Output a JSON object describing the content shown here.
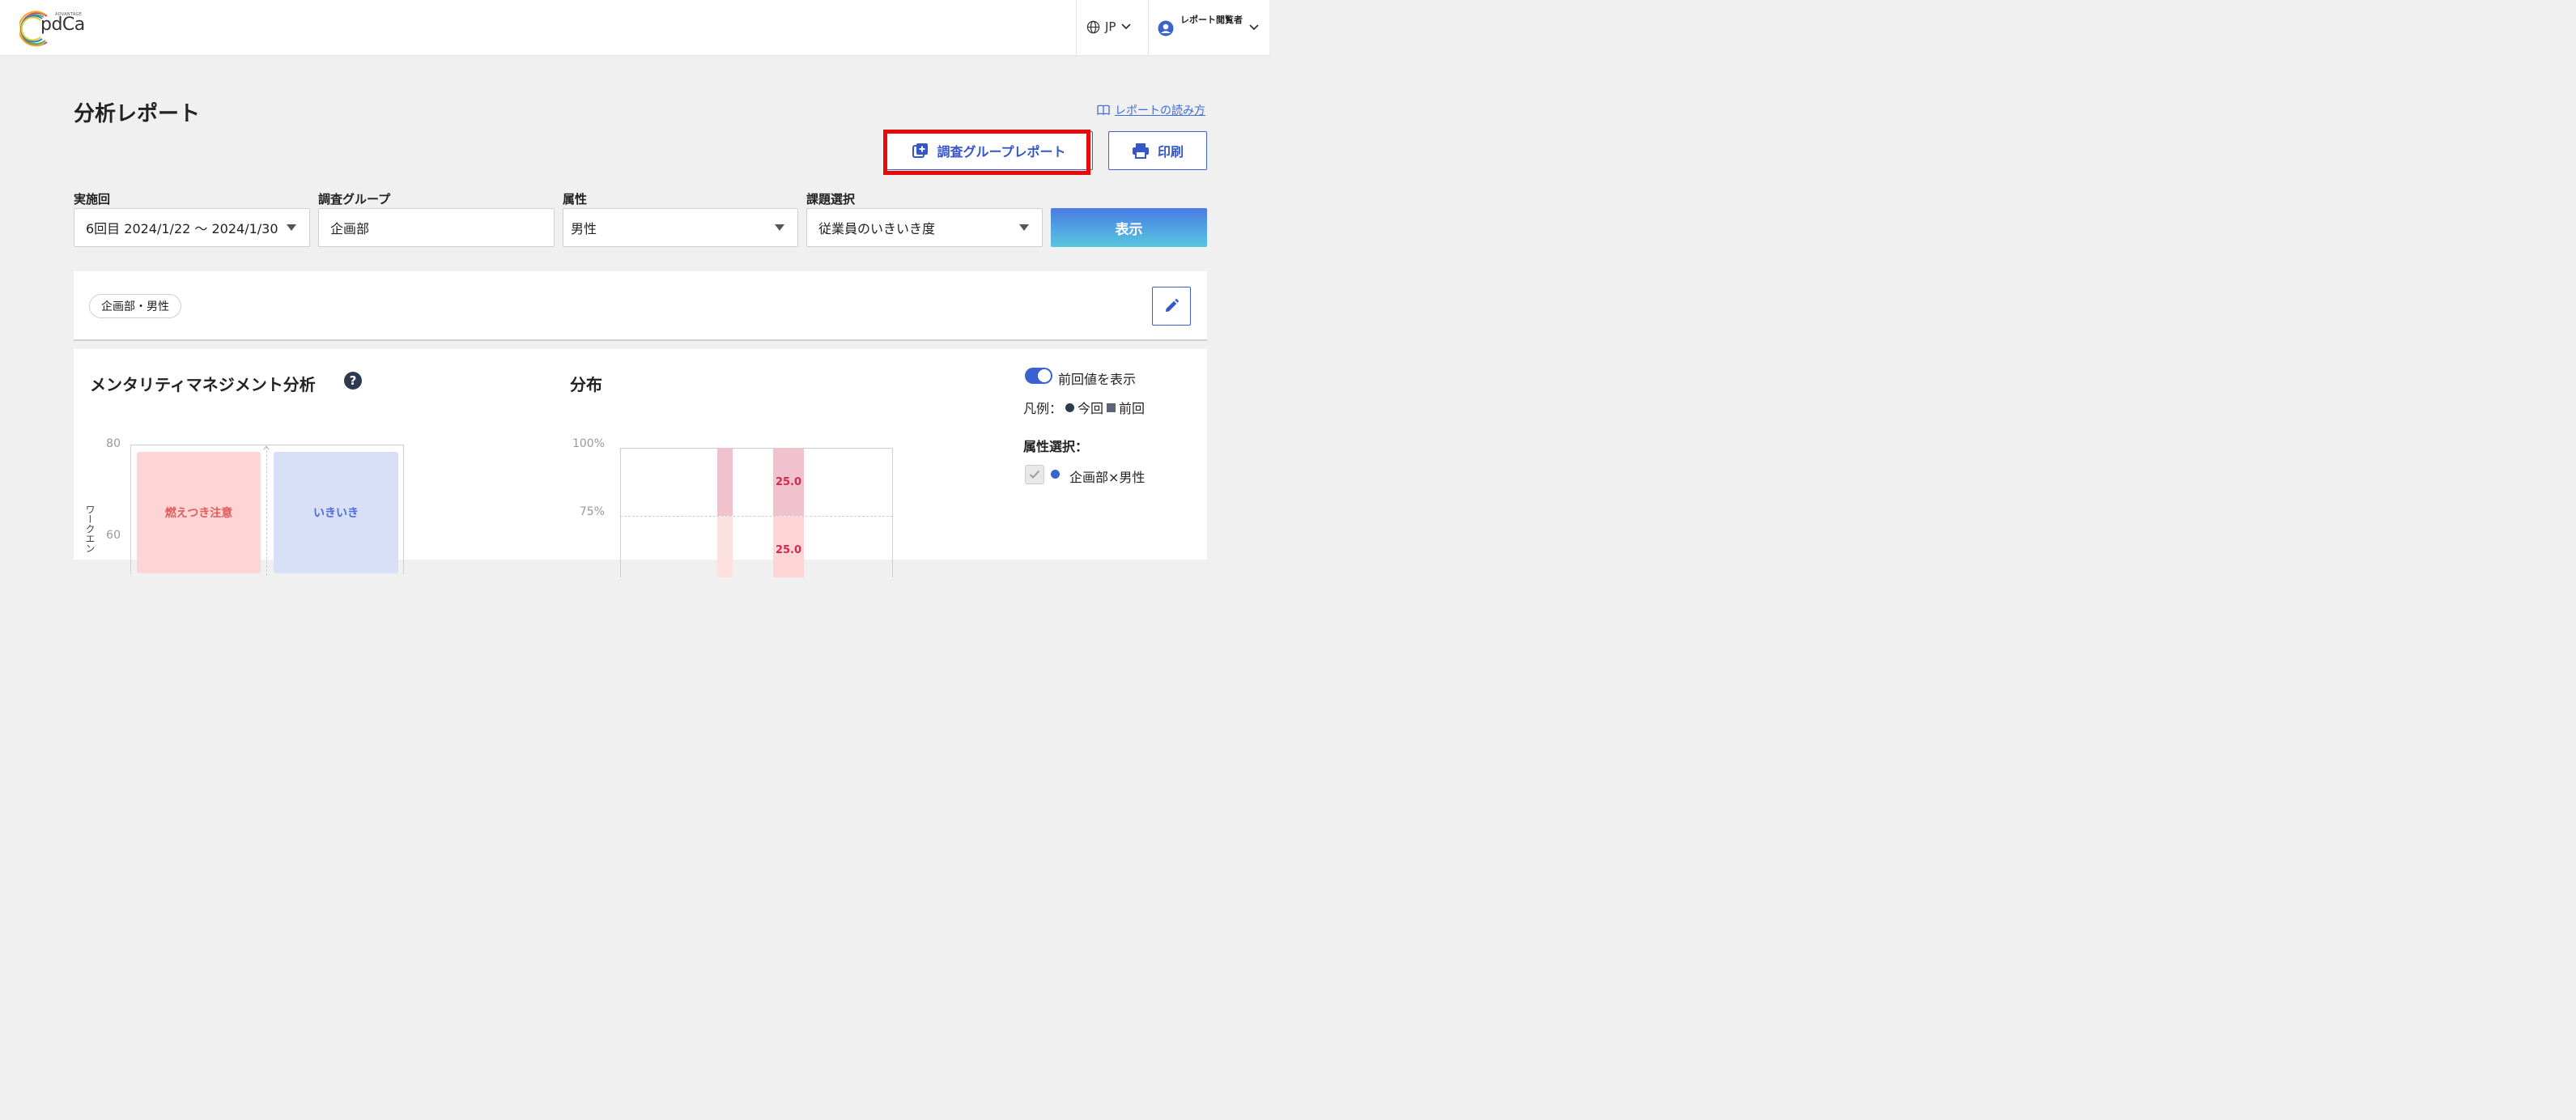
{
  "header": {
    "logo_caption": "ADVANTAGE",
    "logo_text": "pdCa",
    "language": "JP",
    "user_role": "レポート閲覧者"
  },
  "page": {
    "title": "分析レポート",
    "howto_link": "レポートの読み方",
    "group_report_button": "調査グループレポート",
    "print_button": "印刷"
  },
  "filters": {
    "round": {
      "label": "実施回",
      "value": "6回目  2024/1/22 〜 2024/1/30"
    },
    "group": {
      "label": "調査グループ",
      "value": "企画部"
    },
    "attribute": {
      "label": "属性",
      "value": "男性"
    },
    "issue": {
      "label": "課題選択",
      "value": "従業員のいきいき度"
    },
    "show_button": "表示"
  },
  "selection": {
    "chip": "企画部・男性"
  },
  "mentality": {
    "title": "メンタリティマネジメント分析",
    "help": "?",
    "y_ticks": [
      "80",
      "60"
    ],
    "y_title": "ワークエン",
    "quadrant_left": "燃えつき注意",
    "quadrant_right": "いきいき"
  },
  "distribution": {
    "title": "分布",
    "y_ticks": [
      "100%",
      "75%"
    ],
    "bar_label_1": "25.0",
    "bar_label_2": "25.0"
  },
  "legend_panel": {
    "toggle_label": "前回値を表示",
    "toggle_on": true,
    "legend_prefix": "凡例：",
    "legend_current": "今回",
    "legend_previous": "前回",
    "attr_title": "属性選択：",
    "attr_item": "企画部×男性"
  },
  "colors": {
    "accent": "#3a63d1",
    "highlight_box": "#e80a0a",
    "burnout": "#fdd5d5",
    "lively": "#d8e0f8"
  }
}
